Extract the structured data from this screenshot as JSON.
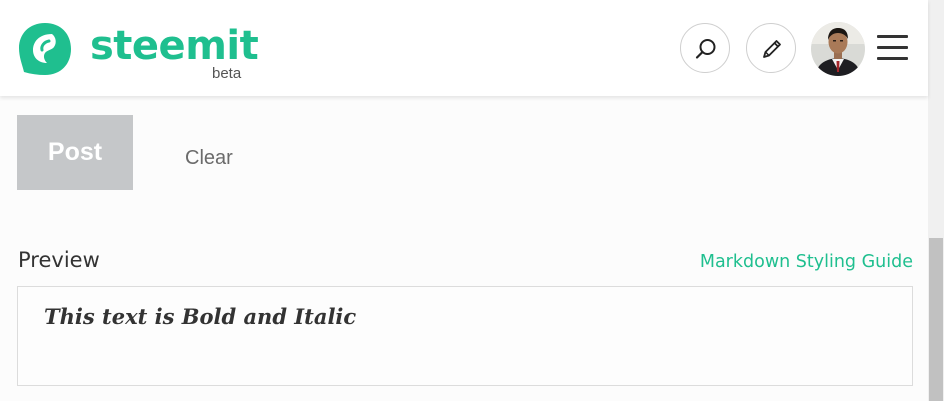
{
  "header": {
    "brand_name": "steemit",
    "brand_tag": "beta",
    "brand_color": "#1fbf8f",
    "icons": {
      "logo": "steemit-logo-icon",
      "search": "search-icon",
      "edit": "pencil-icon",
      "avatar": "user-avatar",
      "menu": "hamburger-menu-icon"
    }
  },
  "editor": {
    "post_label": "Post",
    "clear_label": "Clear"
  },
  "preview": {
    "label": "Preview",
    "guide_link": "Markdown Styling Guide",
    "content": "This text is Bold and Italic"
  }
}
